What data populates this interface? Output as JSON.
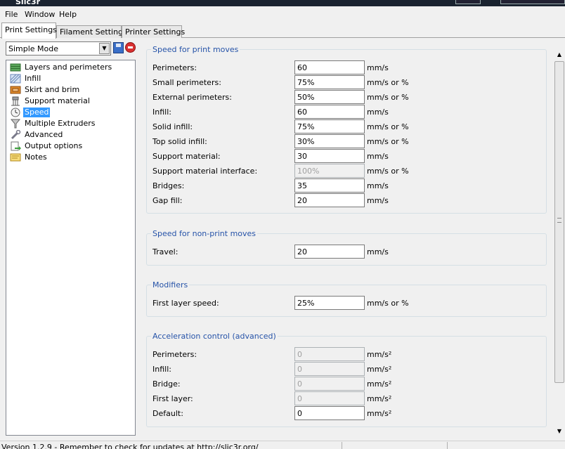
{
  "window": {
    "title": "Slic3r"
  },
  "menu": {
    "items": [
      "File",
      "Window",
      "Help"
    ]
  },
  "tabs": [
    {
      "label": "Print Settings",
      "active": true
    },
    {
      "label": "Filament Settings",
      "active": false
    },
    {
      "label": "Printer Settings",
      "active": false
    }
  ],
  "preset": {
    "selected": "Simple Mode"
  },
  "sidebar": {
    "items": [
      {
        "label": "Layers and perimeters",
        "icon": "layers-icon"
      },
      {
        "label": "Infill",
        "icon": "infill-icon"
      },
      {
        "label": "Skirt and brim",
        "icon": "skirt-brim-icon"
      },
      {
        "label": "Support material",
        "icon": "support-material-icon"
      },
      {
        "label": "Speed",
        "icon": "clock-icon",
        "selected": true
      },
      {
        "label": "Multiple Extruders",
        "icon": "funnel-icon"
      },
      {
        "label": "Advanced",
        "icon": "wrench-icon"
      },
      {
        "label": "Output options",
        "icon": "output-icon"
      },
      {
        "label": "Notes",
        "icon": "notes-icon"
      }
    ]
  },
  "groups": {
    "print_moves": {
      "title": "Speed for print moves",
      "rows": [
        {
          "label": "Perimeters:",
          "value": "60",
          "unit": "mm/s"
        },
        {
          "label": "Small perimeters:",
          "value": "75%",
          "unit": "mm/s or %"
        },
        {
          "label": "External perimeters:",
          "value": "50%",
          "unit": "mm/s or %"
        },
        {
          "label": "Infill:",
          "value": "60",
          "unit": "mm/s"
        },
        {
          "label": "Solid infill:",
          "value": "75%",
          "unit": "mm/s or %"
        },
        {
          "label": "Top solid infill:",
          "value": "30%",
          "unit": "mm/s or %"
        },
        {
          "label": "Support material:",
          "value": "30",
          "unit": "mm/s"
        },
        {
          "label": "Support material interface:",
          "value": "100%",
          "unit": "mm/s or %",
          "disabled": true
        },
        {
          "label": "Bridges:",
          "value": "35",
          "unit": "mm/s"
        },
        {
          "label": "Gap fill:",
          "value": "20",
          "unit": "mm/s"
        }
      ]
    },
    "non_print_moves": {
      "title": "Speed for non-print moves",
      "rows": [
        {
          "label": "Travel:",
          "value": "20",
          "unit": "mm/s"
        }
      ]
    },
    "modifiers": {
      "title": "Modifiers",
      "rows": [
        {
          "label": "First layer speed:",
          "value": "25%",
          "unit": "mm/s or %"
        }
      ]
    },
    "acceleration": {
      "title": "Acceleration control (advanced)",
      "rows": [
        {
          "label": "Perimeters:",
          "value": "0",
          "unit": "mm/s²",
          "disabled": true
        },
        {
          "label": "Infill:",
          "value": "0",
          "unit": "mm/s²",
          "disabled": true
        },
        {
          "label": "Bridge:",
          "value": "0",
          "unit": "mm/s²",
          "disabled": true
        },
        {
          "label": "First layer:",
          "value": "0",
          "unit": "mm/s²",
          "disabled": true
        },
        {
          "label": "Default:",
          "value": "0",
          "unit": "mm/s²"
        }
      ]
    }
  },
  "status": {
    "message": "Version 1.2.9 - Remember to check for updates at http://slic3r.org/"
  }
}
